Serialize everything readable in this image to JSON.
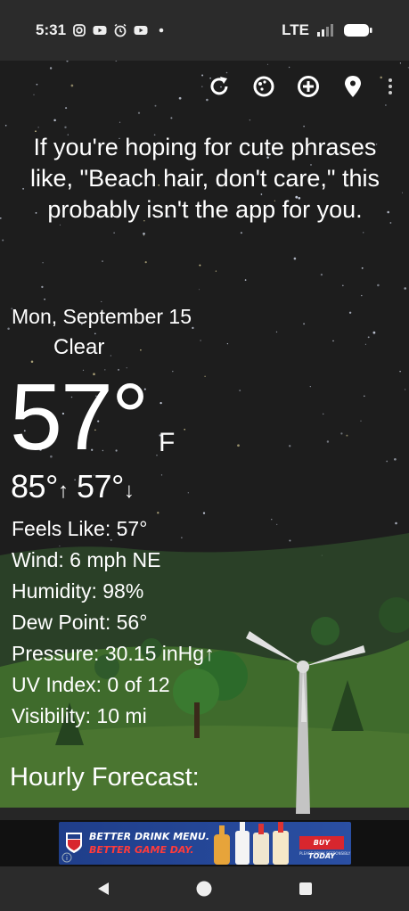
{
  "status_bar": {
    "time": "5:31",
    "notification_icons": [
      "instagram-icon",
      "youtube-icon",
      "alarm-icon",
      "youtube-icon",
      "dot-icon"
    ],
    "network": "LTE",
    "signal_icon": "signal-icon",
    "battery_icon": "battery-icon"
  },
  "toolbar": {
    "icons": [
      "refresh-icon",
      "theme-icon",
      "add-location-icon",
      "location-pin-icon",
      "more-vert-icon"
    ]
  },
  "quote": "If you're hoping for cute phrases like, \"Beach hair, don't care,\" this probably isn't the app for you.",
  "weather": {
    "date": "Mon, September 15",
    "condition": "Clear",
    "condition_icon": "moon-icon",
    "temperature": "57°",
    "unit": "F",
    "high": "85°",
    "high_arrow": "↑",
    "low": "57°",
    "low_arrow": "↓"
  },
  "details": {
    "feels_like": "Feels Like:  57°",
    "wind": "Wind:  6 mph NE",
    "humidity": "Humidity:  98%",
    "dew_point": "Dew Point:  56°",
    "pressure": "Pressure:  30.15 inHg↑",
    "uv_index": "UV Index:  0 of 12",
    "visibility": "Visibility:  10 mi"
  },
  "hourly_title": "Hourly Forecast:",
  "ad": {
    "line1": "BETTER DRINK MENU.",
    "line2": "BETTER GAME DAY.",
    "cta": "BUY TODAY",
    "fine_print": "PLEASE DRINK RESPONSIBLY"
  },
  "nav_bar": {
    "icons": [
      "back-icon",
      "home-icon",
      "recents-icon"
    ]
  },
  "colors": {
    "status_bar": "#2b2b2b",
    "night_sky": "#1d1d1d",
    "grass": "#3f6b2c",
    "moon": "#4a90e2",
    "ad_red": "#d8262e",
    "ad_blue": "#1f3e8a"
  }
}
